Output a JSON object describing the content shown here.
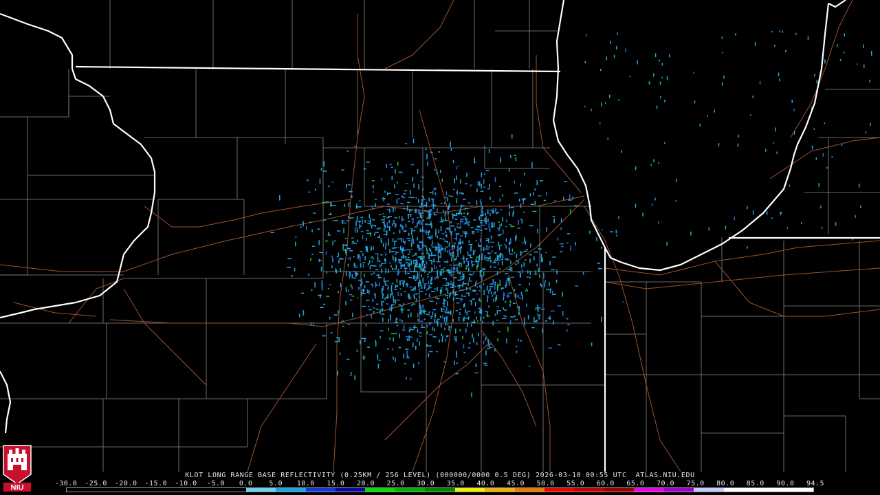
{
  "caption": "KLOT LONG RANGE BASE REFLECTIVITY (0.25KM / 256 LEVEL) (000000/0000 0.5 DEG) 2026-03-10 00:55 UTC  ATLAS.NIU.EDU",
  "scale_labels": [
    "-30.0",
    "-25.0",
    "-20.0",
    "-15.0",
    "-10.0",
    "-5.0",
    "0.0",
    "5.0",
    "10.0",
    "15.0",
    "20.0",
    "25.0",
    "30.0",
    "35.0",
    "40.0",
    "45.0",
    "50.0",
    "55.0",
    "60.0",
    "65.0",
    "70.0",
    "75.0",
    "80.0",
    "85.0",
    "90.0",
    "94.5"
  ],
  "colorbar_colors": [
    "#000000",
    "#000000",
    "#000000",
    "#000000",
    "#000000",
    "#000000",
    "#6ed0f0",
    "#16a6e6",
    "#1438e0",
    "#0a0aa0",
    "#00e000",
    "#00b400",
    "#008800",
    "#f0f000",
    "#f0b000",
    "#f07800",
    "#f00000",
    "#c80000",
    "#a00000",
    "#f000f0",
    "#a000d0",
    "#c8c8ff",
    "#ffffff",
    "#ffffff",
    "#ffffff"
  ],
  "logo": {
    "text": "NIU",
    "color": "#c8102e"
  },
  "map_colors": {
    "state_border": "#ffffff",
    "county_line": "#8a8a8a",
    "highway": "#a0522d",
    "echo_light": "#22a8e0",
    "echo_blue": "#2d6cdf",
    "echo_green": "#1ec81e"
  }
}
